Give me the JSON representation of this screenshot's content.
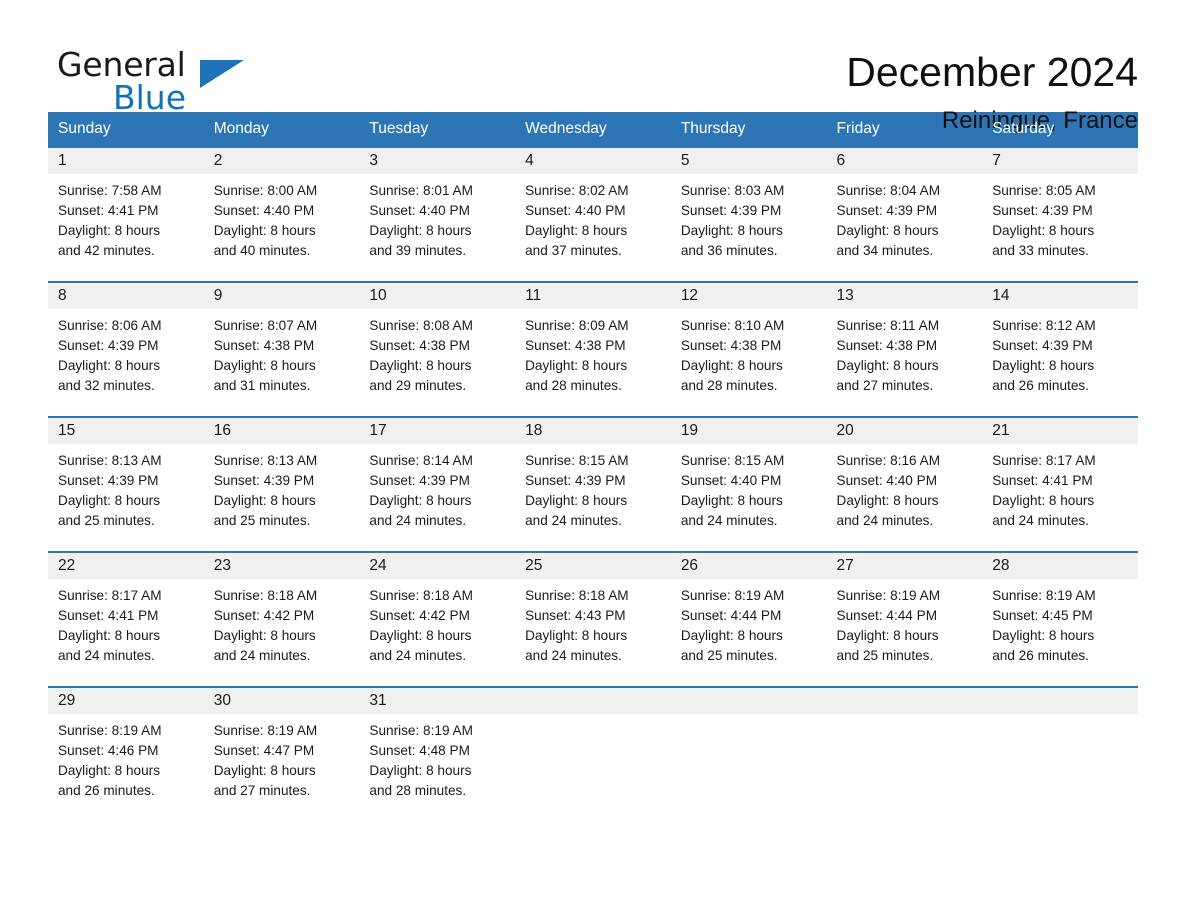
{
  "brand": {
    "name_part1": "General",
    "name_part2": "Blue",
    "triangle_icon": "brand-triangle-icon",
    "accent_color": "#1272b9"
  },
  "header": {
    "title": "December 2024",
    "subtitle": "Reiningue, France"
  },
  "theme": {
    "header_blue": "#2e75b6",
    "daynum_band": "#f0f0f0",
    "text": "#1a1a1a"
  },
  "weekday_headers": [
    "Sunday",
    "Monday",
    "Tuesday",
    "Wednesday",
    "Thursday",
    "Friday",
    "Saturday"
  ],
  "weeks": [
    [
      {
        "day": "1",
        "sunrise": "Sunrise: 7:58 AM",
        "sunset": "Sunset: 4:41 PM",
        "daylight1": "Daylight: 8 hours",
        "daylight2": "and 42 minutes."
      },
      {
        "day": "2",
        "sunrise": "Sunrise: 8:00 AM",
        "sunset": "Sunset: 4:40 PM",
        "daylight1": "Daylight: 8 hours",
        "daylight2": "and 40 minutes."
      },
      {
        "day": "3",
        "sunrise": "Sunrise: 8:01 AM",
        "sunset": "Sunset: 4:40 PM",
        "daylight1": "Daylight: 8 hours",
        "daylight2": "and 39 minutes."
      },
      {
        "day": "4",
        "sunrise": "Sunrise: 8:02 AM",
        "sunset": "Sunset: 4:40 PM",
        "daylight1": "Daylight: 8 hours",
        "daylight2": "and 37 minutes."
      },
      {
        "day": "5",
        "sunrise": "Sunrise: 8:03 AM",
        "sunset": "Sunset: 4:39 PM",
        "daylight1": "Daylight: 8 hours",
        "daylight2": "and 36 minutes."
      },
      {
        "day": "6",
        "sunrise": "Sunrise: 8:04 AM",
        "sunset": "Sunset: 4:39 PM",
        "daylight1": "Daylight: 8 hours",
        "daylight2": "and 34 minutes."
      },
      {
        "day": "7",
        "sunrise": "Sunrise: 8:05 AM",
        "sunset": "Sunset: 4:39 PM",
        "daylight1": "Daylight: 8 hours",
        "daylight2": "and 33 minutes."
      }
    ],
    [
      {
        "day": "8",
        "sunrise": "Sunrise: 8:06 AM",
        "sunset": "Sunset: 4:39 PM",
        "daylight1": "Daylight: 8 hours",
        "daylight2": "and 32 minutes."
      },
      {
        "day": "9",
        "sunrise": "Sunrise: 8:07 AM",
        "sunset": "Sunset: 4:38 PM",
        "daylight1": "Daylight: 8 hours",
        "daylight2": "and 31 minutes."
      },
      {
        "day": "10",
        "sunrise": "Sunrise: 8:08 AM",
        "sunset": "Sunset: 4:38 PM",
        "daylight1": "Daylight: 8 hours",
        "daylight2": "and 29 minutes."
      },
      {
        "day": "11",
        "sunrise": "Sunrise: 8:09 AM",
        "sunset": "Sunset: 4:38 PM",
        "daylight1": "Daylight: 8 hours",
        "daylight2": "and 28 minutes."
      },
      {
        "day": "12",
        "sunrise": "Sunrise: 8:10 AM",
        "sunset": "Sunset: 4:38 PM",
        "daylight1": "Daylight: 8 hours",
        "daylight2": "and 28 minutes."
      },
      {
        "day": "13",
        "sunrise": "Sunrise: 8:11 AM",
        "sunset": "Sunset: 4:38 PM",
        "daylight1": "Daylight: 8 hours",
        "daylight2": "and 27 minutes."
      },
      {
        "day": "14",
        "sunrise": "Sunrise: 8:12 AM",
        "sunset": "Sunset: 4:39 PM",
        "daylight1": "Daylight: 8 hours",
        "daylight2": "and 26 minutes."
      }
    ],
    [
      {
        "day": "15",
        "sunrise": "Sunrise: 8:13 AM",
        "sunset": "Sunset: 4:39 PM",
        "daylight1": "Daylight: 8 hours",
        "daylight2": "and 25 minutes."
      },
      {
        "day": "16",
        "sunrise": "Sunrise: 8:13 AM",
        "sunset": "Sunset: 4:39 PM",
        "daylight1": "Daylight: 8 hours",
        "daylight2": "and 25 minutes."
      },
      {
        "day": "17",
        "sunrise": "Sunrise: 8:14 AM",
        "sunset": "Sunset: 4:39 PM",
        "daylight1": "Daylight: 8 hours",
        "daylight2": "and 24 minutes."
      },
      {
        "day": "18",
        "sunrise": "Sunrise: 8:15 AM",
        "sunset": "Sunset: 4:39 PM",
        "daylight1": "Daylight: 8 hours",
        "daylight2": "and 24 minutes."
      },
      {
        "day": "19",
        "sunrise": "Sunrise: 8:15 AM",
        "sunset": "Sunset: 4:40 PM",
        "daylight1": "Daylight: 8 hours",
        "daylight2": "and 24 minutes."
      },
      {
        "day": "20",
        "sunrise": "Sunrise: 8:16 AM",
        "sunset": "Sunset: 4:40 PM",
        "daylight1": "Daylight: 8 hours",
        "daylight2": "and 24 minutes."
      },
      {
        "day": "21",
        "sunrise": "Sunrise: 8:17 AM",
        "sunset": "Sunset: 4:41 PM",
        "daylight1": "Daylight: 8 hours",
        "daylight2": "and 24 minutes."
      }
    ],
    [
      {
        "day": "22",
        "sunrise": "Sunrise: 8:17 AM",
        "sunset": "Sunset: 4:41 PM",
        "daylight1": "Daylight: 8 hours",
        "daylight2": "and 24 minutes."
      },
      {
        "day": "23",
        "sunrise": "Sunrise: 8:18 AM",
        "sunset": "Sunset: 4:42 PM",
        "daylight1": "Daylight: 8 hours",
        "daylight2": "and 24 minutes."
      },
      {
        "day": "24",
        "sunrise": "Sunrise: 8:18 AM",
        "sunset": "Sunset: 4:42 PM",
        "daylight1": "Daylight: 8 hours",
        "daylight2": "and 24 minutes."
      },
      {
        "day": "25",
        "sunrise": "Sunrise: 8:18 AM",
        "sunset": "Sunset: 4:43 PM",
        "daylight1": "Daylight: 8 hours",
        "daylight2": "and 24 minutes."
      },
      {
        "day": "26",
        "sunrise": "Sunrise: 8:19 AM",
        "sunset": "Sunset: 4:44 PM",
        "daylight1": "Daylight: 8 hours",
        "daylight2": "and 25 minutes."
      },
      {
        "day": "27",
        "sunrise": "Sunrise: 8:19 AM",
        "sunset": "Sunset: 4:44 PM",
        "daylight1": "Daylight: 8 hours",
        "daylight2": "and 25 minutes."
      },
      {
        "day": "28",
        "sunrise": "Sunrise: 8:19 AM",
        "sunset": "Sunset: 4:45 PM",
        "daylight1": "Daylight: 8 hours",
        "daylight2": "and 26 minutes."
      }
    ],
    [
      {
        "day": "29",
        "sunrise": "Sunrise: 8:19 AM",
        "sunset": "Sunset: 4:46 PM",
        "daylight1": "Daylight: 8 hours",
        "daylight2": "and 26 minutes."
      },
      {
        "day": "30",
        "sunrise": "Sunrise: 8:19 AM",
        "sunset": "Sunset: 4:47 PM",
        "daylight1": "Daylight: 8 hours",
        "daylight2": "and 27 minutes."
      },
      {
        "day": "31",
        "sunrise": "Sunrise: 8:19 AM",
        "sunset": "Sunset: 4:48 PM",
        "daylight1": "Daylight: 8 hours",
        "daylight2": "and 28 minutes."
      },
      {
        "day": "",
        "sunrise": "",
        "sunset": "",
        "daylight1": "",
        "daylight2": ""
      },
      {
        "day": "",
        "sunrise": "",
        "sunset": "",
        "daylight1": "",
        "daylight2": ""
      },
      {
        "day": "",
        "sunrise": "",
        "sunset": "",
        "daylight1": "",
        "daylight2": ""
      },
      {
        "day": "",
        "sunrise": "",
        "sunset": "",
        "daylight1": "",
        "daylight2": ""
      }
    ]
  ]
}
